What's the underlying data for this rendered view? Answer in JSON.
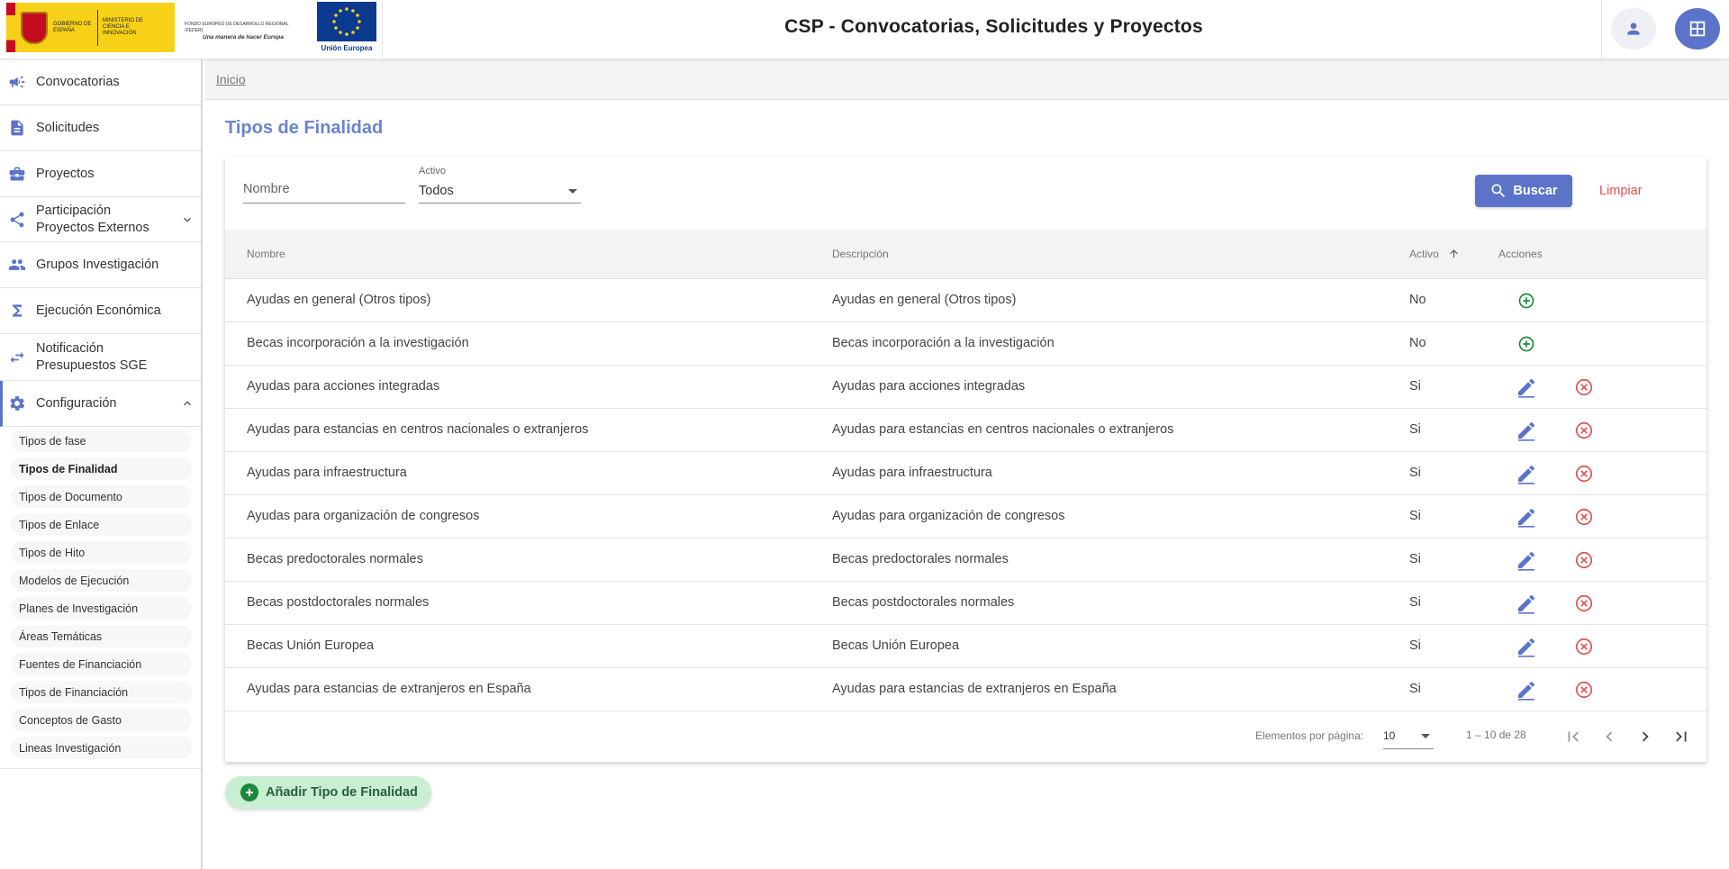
{
  "header": {
    "title": "CSP - Convocatorias, Solicitudes y Proyectos",
    "gobierno_text": "GOBIERNO DE ESPAÑA",
    "ministerio_text": "MINISTERIO DE CIENCIA E INNOVACIÓN",
    "feder_text": "FONDO EUROPEO DE DESARROLLO REGIONAL (FEDER)",
    "feder_motto": "Una manera de hacer Europa",
    "eu_text": "Unión Europea",
    "user_icon": "person-icon",
    "apps_icon": "apps-grid-icon"
  },
  "sidebar": {
    "items": [
      {
        "label": "Convocatorias",
        "icon": "megaphone-icon"
      },
      {
        "label": "Solicitudes",
        "icon": "document-icon"
      },
      {
        "label": "Proyectos",
        "icon": "briefcase-icon"
      },
      {
        "label": "Participación Proyectos Externos",
        "icon": "share-icon"
      },
      {
        "label": "Grupos Investigación",
        "icon": "group-icon"
      },
      {
        "label": "Ejecución Económica",
        "icon": "sigma-icon"
      },
      {
        "label": "Notificación Presupuestos SGE",
        "icon": "swap-icon"
      },
      {
        "label": "Configuración",
        "icon": "gear-icon"
      }
    ],
    "sub_items": [
      "Tipos de fase",
      "Tipos de Finalidad",
      "Tipos de Documento",
      "Tipos de Enlace",
      "Tipos de Hito",
      "Modelos de Ejecución",
      "Planes de Investigación",
      "Áreas Temáticas",
      "Fuentes de Financiación",
      "Tipos de Financiación",
      "Conceptos de Gasto",
      "Lineas Investigación"
    ],
    "selected_sub": "Tipos de Finalidad"
  },
  "breadcrumb": "Inicio",
  "page_title": "Tipos de Finalidad",
  "filters": {
    "nombre_placeholder": "Nombre",
    "activo_label": "Activo",
    "activo_value": "Todos",
    "buscar": "Buscar",
    "limpiar": "Limpiar"
  },
  "table": {
    "headers": [
      "Nombre",
      "Descripción",
      "Activo",
      "Acciones"
    ],
    "sort_icon": "arrow-up-icon",
    "rows": [
      {
        "nombre": "Ayudas en general (Otros tipos)",
        "descripcion": "Ayudas en general (Otros tipos)",
        "activo": "No"
      },
      {
        "nombre": "Becas incorporación a la investigación",
        "descripcion": "Becas incorporación a la investigación",
        "activo": "No"
      },
      {
        "nombre": "Ayudas para acciones integradas",
        "descripcion": "Ayudas para acciones integradas",
        "activo": "Si"
      },
      {
        "nombre": "Ayudas para estancias en centros nacionales o extranjeros",
        "descripcion": "Ayudas para estancias en centros nacionales o extranjeros",
        "activo": "Si"
      },
      {
        "nombre": "Ayudas para infraestructura",
        "descripcion": "Ayudas para infraestructura",
        "activo": "Si"
      },
      {
        "nombre": "Ayudas para organización de congresos",
        "descripcion": "Ayudas para organización de congresos",
        "activo": "Si"
      },
      {
        "nombre": "Becas predoctorales normales",
        "descripcion": "Becas predoctorales normales",
        "activo": "Si"
      },
      {
        "nombre": "Becas postdoctorales normales",
        "descripcion": "Becas postdoctorales normales",
        "activo": "Si"
      },
      {
        "nombre": "Becas Unión Europea",
        "descripcion": "Becas Unión Europea",
        "activo": "Si"
      },
      {
        "nombre": "Ayudas para estancias de extranjeros en España",
        "descripcion": "Ayudas para estancias de extranjeros en España",
        "activo": "Si"
      }
    ]
  },
  "paginator": {
    "label": "Elementos por página:",
    "page_size": "10",
    "range": "1 – 10 de 28"
  },
  "add_button": "Añadir Tipo de Finalidad",
  "colors": {
    "primary": "#5b74c9",
    "title": "#6a84d0",
    "danger": "#e05050",
    "success": "#1b8a3a"
  }
}
